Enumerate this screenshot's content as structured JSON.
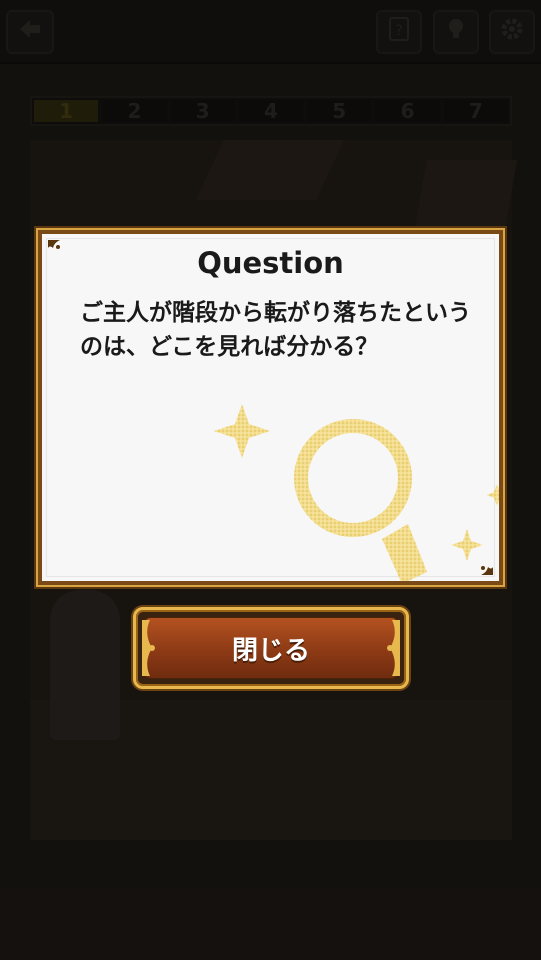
{
  "topbar": {
    "back_icon": "arrow-left-icon",
    "help_icon": "question-card-icon",
    "hint_icon": "lightbulb-icon",
    "settings_icon": "gear-icon"
  },
  "progress": {
    "steps": [
      "1",
      "2",
      "3",
      "4",
      "5",
      "6",
      "7"
    ],
    "current": "1"
  },
  "modal": {
    "title": "Question",
    "question": "ご主人が階段から転がり落ちたというのは、どこを見れば分かる？",
    "decoration_icon": "magnifying-glass-icon"
  },
  "close_button": {
    "label": "閉じる"
  },
  "colors": {
    "frame": "#7a4a16",
    "gold": "#e7b84d",
    "button": "#9a4119",
    "sparkle": "#e8c54a"
  }
}
